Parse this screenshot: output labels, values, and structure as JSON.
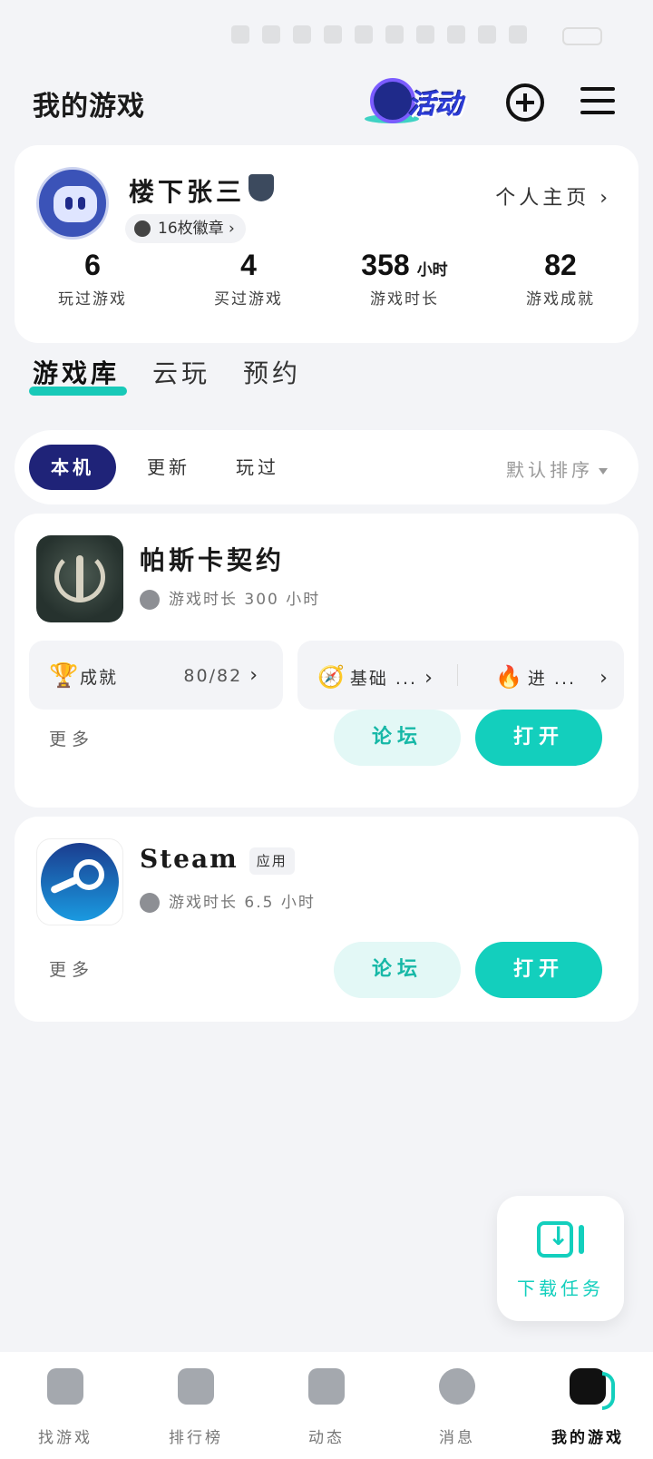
{
  "app": {
    "title": "我的游戏",
    "activity_label": "活动"
  },
  "profile": {
    "username": "楼下张三",
    "badges": "16枚徽章 ›",
    "homepage_link": "个人主页 ›",
    "stats": [
      {
        "value": "6",
        "unit": "",
        "label": "玩过游戏"
      },
      {
        "value": "4",
        "unit": "",
        "label": "买过游戏"
      },
      {
        "value": "358",
        "unit": "小时",
        "label": "游戏时长"
      },
      {
        "value": "82",
        "unit": "",
        "label": "游戏成就"
      }
    ]
  },
  "tabs": [
    "游戏库",
    "云玩",
    "预约"
  ],
  "filters": {
    "chips": [
      "本机",
      "更新",
      "玩过"
    ],
    "sort_label": "默认排序"
  },
  "games": [
    {
      "title": "帕斯卡契约",
      "playtime": "游戏时长 300 小时",
      "achievement_label": "成就",
      "achievement_count": "80/82",
      "guide_basic": "基础 ...",
      "guide_advanced": "进 ...",
      "more": "更多",
      "forum": "论坛",
      "open": "打开"
    },
    {
      "title": "Steam",
      "tag": "应用",
      "playtime": "游戏时长 6.5 小时",
      "more": "更多",
      "forum": "论坛",
      "open": "打开"
    }
  ],
  "download": {
    "label": "下载任务"
  },
  "bottom_nav": [
    {
      "label": "找游戏",
      "icon": "find-game-icon"
    },
    {
      "label": "排行榜",
      "icon": "leaderboard-icon"
    },
    {
      "label": "动态",
      "icon": "feed-icon"
    },
    {
      "label": "消息",
      "icon": "message-icon"
    },
    {
      "label": "我的游戏",
      "icon": "my-games-icon"
    }
  ],
  "colors": {
    "accent": "#13cfbd",
    "chip_active": "#1f2378",
    "background": "#f3f4f7"
  }
}
